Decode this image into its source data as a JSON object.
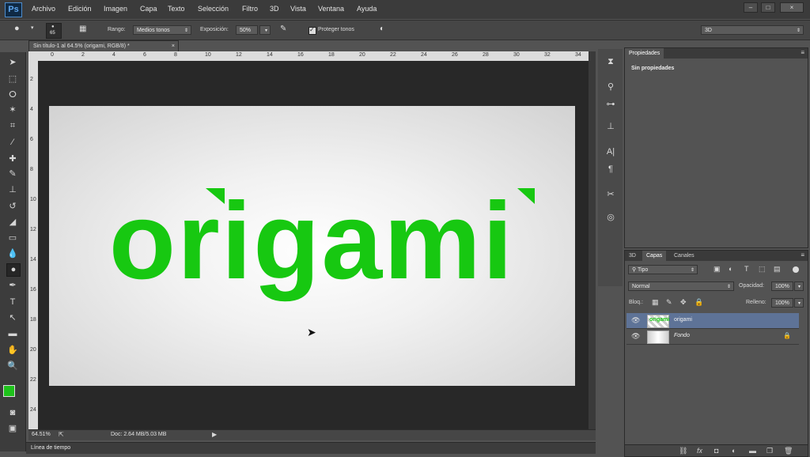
{
  "app": {
    "logo": "Ps"
  },
  "menu": [
    "Archivo",
    "Edición",
    "Imagen",
    "Capa",
    "Texto",
    "Selección",
    "Filtro",
    "3D",
    "Vista",
    "Ventana",
    "Ayuda"
  ],
  "window_buttons": [
    "–",
    "□",
    "×"
  ],
  "options": {
    "brush_size": "65",
    "range_label": "Rango:",
    "range_value": "Medios tonos",
    "exposure_label": "Exposición:",
    "exposure_value": "50%",
    "protect_label": "Proteger tonos",
    "workspace": "3D"
  },
  "document": {
    "tab_title": "Sin título-1 al 64.5% (origami, RGB/8) *",
    "tab_close": "×",
    "ruler_top": [
      "0",
      "2",
      "4",
      "6",
      "8",
      "10",
      "12",
      "14",
      "16",
      "18",
      "20",
      "22",
      "24",
      "26",
      "28",
      "30",
      "32",
      "34"
    ],
    "ruler_left": [
      "2",
      "4",
      "6",
      "8",
      "10",
      "12",
      "14",
      "16",
      "18",
      "20",
      "22",
      "24"
    ],
    "artwork_text": "origami",
    "artwork_color": "#17c811"
  },
  "status": {
    "zoom": "64.51%",
    "doc_info": "Doc: 2.64 MB/5.03 MB"
  },
  "timeline_label": "Línea de tiempo",
  "properties": {
    "tab": "Propiedades",
    "empty_text": "Sin propiedades"
  },
  "layers_panel": {
    "tabs": [
      "3D",
      "Capas",
      "Canales"
    ],
    "filter_kind": "Tipo",
    "blend_mode": "Normal",
    "opacity_label": "Opacidad:",
    "opacity_value": "100%",
    "lock_label": "Bloq.:",
    "fill_label": "Relleno:",
    "fill_value": "100%",
    "layers": [
      {
        "name": "origami",
        "selected": true
      },
      {
        "name": "Fondo",
        "locked": true
      }
    ],
    "footer_icons": [
      "link-icon",
      "fx-icon",
      "mask-icon",
      "adjustment-icon",
      "group-icon",
      "new-layer-icon",
      "trash-icon"
    ]
  },
  "colors": {
    "foreground": "#1ec11b",
    "background": "#ffffff",
    "selected_layer": "#5e7397"
  }
}
